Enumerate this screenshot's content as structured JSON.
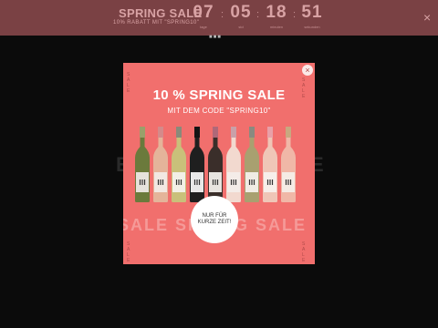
{
  "banner": {
    "title": "SPRING SALE",
    "subtitle": "10% RABATT MIT \"SPRING10\"",
    "countdown": [
      {
        "value": "07",
        "label": "tage"
      },
      {
        "value": "05",
        "label": "std"
      },
      {
        "value": "18",
        "label": "minuten"
      },
      {
        "value": "51",
        "label": "sekunden"
      }
    ],
    "separator": ":",
    "close_glyph": "×"
  },
  "background": {
    "dots": "■■■",
    "text_left": "E",
    "text_right": "E"
  },
  "popup": {
    "corner_label": "S A L E",
    "close_glyph": "×",
    "headline": "10 % SPRING SALE",
    "code_line": "MIT DEM CODE \"SPRING10\"",
    "watermark": "SALE SPRING SALE",
    "badge_text": "NUR FÜR KURZE ZEIT!",
    "bottle_colors": [
      {
        "glass": "#6b7a3c",
        "capsule": "#9aa06a",
        "label": "#e6e2dc"
      },
      {
        "glass": "#e4b49a",
        "capsule": "#d48a8a",
        "label": "#f2e8e2"
      },
      {
        "glass": "#c9c07a",
        "capsule": "#8a8a7a",
        "label": "#f2efe6"
      },
      {
        "glass": "#1f1f1f",
        "capsule": "#141414",
        "label": "#e8e8e8"
      },
      {
        "glass": "#3a2e2a",
        "capsule": "#b06878",
        "label": "#e8e4e0"
      },
      {
        "glass": "#f2d9cf",
        "capsule": "#c9a0a8",
        "label": "#f4ece8"
      },
      {
        "glass": "#a8a070",
        "capsule": "#8a8a80",
        "label": "#f0ece4"
      },
      {
        "glass": "#efc6b7",
        "capsule": "#e8a0a8",
        "label": "#f7efea"
      },
      {
        "glass": "#f0b7a7",
        "capsule": "#c8a880",
        "label": "#f5ebe5"
      }
    ]
  }
}
